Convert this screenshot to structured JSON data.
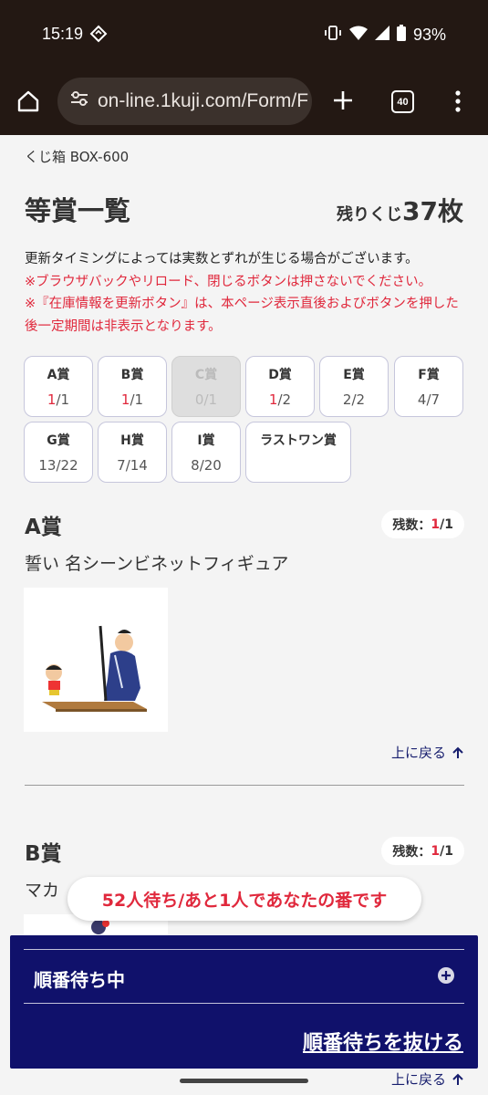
{
  "status_bar": {
    "time": "15:19",
    "battery": "93%"
  },
  "browser": {
    "url": "on-line.1kuji.com/Form/F",
    "tab_count": "40"
  },
  "page": {
    "breadcrumb": "くじ箱 BOX-600",
    "title": "等賞一覧",
    "remaining_prefix": "残りくじ",
    "remaining_count": "37枚",
    "note_black": "更新タイミングによっては実数とずれが生じる場合がございます。",
    "note_red1": "※ブラウザバックやリロード、閉じるボタンは押さないでください。",
    "note_red2": "※『在庫情報を更新ボタン』は、本ページ表示直後およびボタンを押した後一定期間は非表示となります。"
  },
  "grades": [
    {
      "label": "A賞",
      "remaining": "1",
      "total": "/1",
      "red": true,
      "disabled": false
    },
    {
      "label": "B賞",
      "remaining": "1",
      "total": "/1",
      "red": true,
      "disabled": false
    },
    {
      "label": "C賞",
      "remaining": "0",
      "total": "/1",
      "red": false,
      "disabled": true
    },
    {
      "label": "D賞",
      "remaining": "1",
      "total": "/2",
      "red": true,
      "disabled": false
    },
    {
      "label": "E賞",
      "remaining": "2",
      "total": "/2",
      "red": false,
      "disabled": false
    },
    {
      "label": "F賞",
      "remaining": "4",
      "total": "/7",
      "red": false,
      "disabled": false
    },
    {
      "label": "G賞",
      "remaining": "13",
      "total": "/22",
      "red": false,
      "disabled": false
    },
    {
      "label": "H賞",
      "remaining": "7",
      "total": "/14",
      "red": false,
      "disabled": false
    },
    {
      "label": "I賞",
      "remaining": "8",
      "total": "/20",
      "red": false,
      "disabled": false
    },
    {
      "label": "ラストワン賞",
      "remaining": "",
      "total": "",
      "red": false,
      "disabled": false
    }
  ],
  "sections": [
    {
      "title": "A賞",
      "count_label": "残数：",
      "count_remaining": "1",
      "count_total": "/1",
      "prize_name": "誓い 名シーンビネットフィギュア"
    },
    {
      "title": "B賞",
      "count_label": "残数：",
      "count_remaining": "1",
      "count_total": "/1",
      "prize_name": "マカ"
    }
  ],
  "back_to_top": "上に戻る",
  "toast": "52人待ち/あと1人であなたの番です",
  "queue": {
    "label": "順番待ち中",
    "exit": "順番待ちを抜ける"
  },
  "colors": {
    "accent_red": "#e0283c",
    "navy": "#10116b",
    "chrome": "#231813"
  }
}
